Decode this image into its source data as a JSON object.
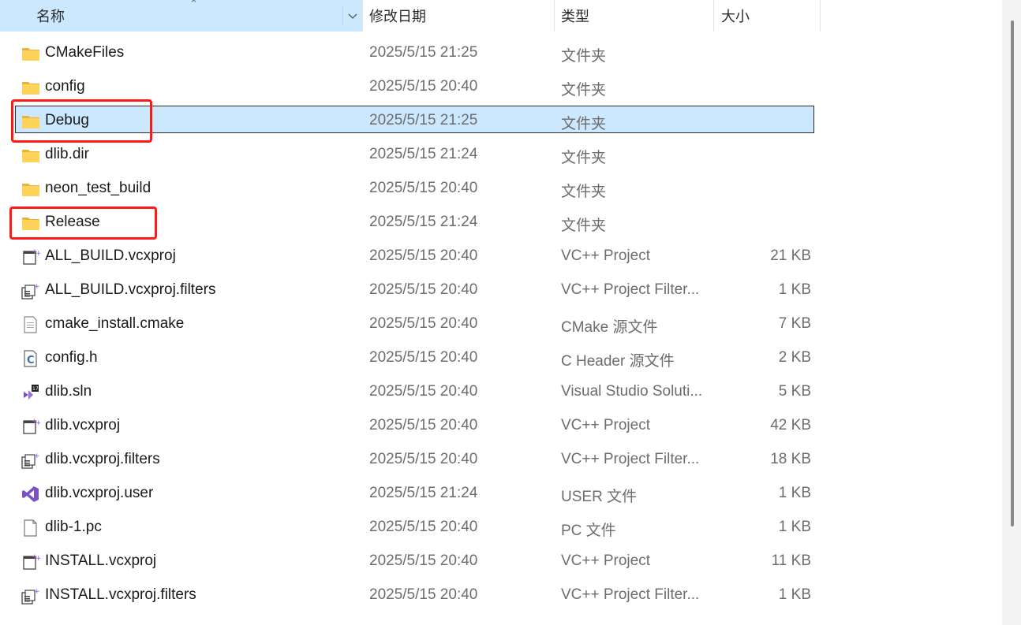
{
  "header": {
    "name_label": "名称",
    "date_label": "修改日期",
    "type_label": "类型",
    "size_label": "大小"
  },
  "files": [
    {
      "name": "CMakeFiles",
      "date": "2025/5/15 21:25",
      "type": "文件夹",
      "size": "",
      "icon": "folder-icon"
    },
    {
      "name": "config",
      "date": "2025/5/15 20:40",
      "type": "文件夹",
      "size": "",
      "icon": "folder-icon"
    },
    {
      "name": "Debug",
      "date": "2025/5/15 21:25",
      "type": "文件夹",
      "size": "",
      "icon": "folder-icon",
      "selected": true
    },
    {
      "name": "dlib.dir",
      "date": "2025/5/15 21:24",
      "type": "文件夹",
      "size": "",
      "icon": "folder-icon"
    },
    {
      "name": "neon_test_build",
      "date": "2025/5/15 20:40",
      "type": "文件夹",
      "size": "",
      "icon": "folder-icon"
    },
    {
      "name": "Release",
      "date": "2025/5/15 21:24",
      "type": "文件夹",
      "size": "",
      "icon": "folder-icon"
    },
    {
      "name": "ALL_BUILD.vcxproj",
      "date": "2025/5/15 20:40",
      "type": "VC++ Project",
      "size": "21 KB",
      "icon": "vcxproj-icon"
    },
    {
      "name": "ALL_BUILD.vcxproj.filters",
      "date": "2025/5/15 20:40",
      "type": "VC++ Project Filter...",
      "size": "1 KB",
      "icon": "filters-icon"
    },
    {
      "name": "cmake_install.cmake",
      "date": "2025/5/15 20:40",
      "type": "CMake 源文件",
      "size": "7 KB",
      "icon": "text-file-icon"
    },
    {
      "name": "config.h",
      "date": "2025/5/15 20:40",
      "type": "C Header 源文件",
      "size": "2 KB",
      "icon": "c-header-icon"
    },
    {
      "name": "dlib.sln",
      "date": "2025/5/15 20:40",
      "type": "Visual Studio Soluti...",
      "size": "5 KB",
      "icon": "sln-icon"
    },
    {
      "name": "dlib.vcxproj",
      "date": "2025/5/15 20:40",
      "type": "VC++ Project",
      "size": "42 KB",
      "icon": "vcxproj-icon"
    },
    {
      "name": "dlib.vcxproj.filters",
      "date": "2025/5/15 20:40",
      "type": "VC++ Project Filter...",
      "size": "18 KB",
      "icon": "filters-icon"
    },
    {
      "name": "dlib.vcxproj.user",
      "date": "2025/5/15 21:24",
      "type": "USER 文件",
      "size": "1 KB",
      "icon": "vs-icon"
    },
    {
      "name": "dlib-1.pc",
      "date": "2025/5/15 20:40",
      "type": "PC 文件",
      "size": "1 KB",
      "icon": "blank-file-icon"
    },
    {
      "name": "INSTALL.vcxproj",
      "date": "2025/5/15 20:40",
      "type": "VC++ Project",
      "size": "11 KB",
      "icon": "vcxproj-icon"
    },
    {
      "name": "INSTALL.vcxproj.filters",
      "date": "2025/5/15 20:40",
      "type": "VC++ Project Filter...",
      "size": "1 KB",
      "icon": "filters-icon"
    }
  ],
  "highlight_color": "#ff1a1a",
  "selection_color": "#cce8ff"
}
